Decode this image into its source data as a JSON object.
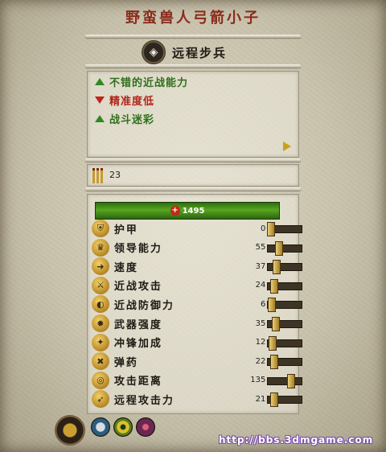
{
  "unit": {
    "title": "野蛮兽人弓箭小子",
    "class_name": "远程步兵",
    "class_icon": "ranged-infantry-icon"
  },
  "traits": [
    {
      "text": "不错的近战能力",
      "type": "positive",
      "color": "#2f6f1c"
    },
    {
      "text": "精准度低",
      "type": "negative",
      "color": "#b3241a"
    },
    {
      "text": "战斗迷彩",
      "type": "positive",
      "color": "#2f6f1c"
    }
  ],
  "ammo": {
    "value": "23",
    "icon": "arrows-ammo-icon"
  },
  "health": {
    "value": "1495",
    "icon": "health-cross-icon"
  },
  "stats": [
    {
      "label": "护甲",
      "value": "0",
      "icon": "armor-icon",
      "level": 0.0
    },
    {
      "label": "领导能力",
      "value": "55",
      "icon": "leadership-icon",
      "level": 0.28
    },
    {
      "label": "速度",
      "value": "37",
      "icon": "speed-icon",
      "level": 0.2
    },
    {
      "label": "近战攻击",
      "value": "24",
      "icon": "melee-attack-icon",
      "level": 0.12
    },
    {
      "label": "近战防御力",
      "value": "6",
      "icon": "melee-defense-icon",
      "level": 0.03
    },
    {
      "label": "武器强度",
      "value": "35",
      "icon": "weapon-strength-icon",
      "level": 0.18
    },
    {
      "label": "冲锋加成",
      "value": "12",
      "icon": "charge-bonus-icon",
      "level": 0.06
    },
    {
      "label": "弹药",
      "value": "22",
      "icon": "ammunition-icon",
      "level": 0.12
    },
    {
      "label": "攻击距离",
      "value": "135",
      "icon": "range-icon",
      "level": 0.72
    },
    {
      "label": "远程攻击力",
      "value": "21",
      "icon": "missile-damage-icon",
      "level": 0.11
    }
  ],
  "abilities": [
    "faction-emblem-icon",
    "ability-shield-icon",
    "ability-eye-icon",
    "ability-claw-icon"
  ],
  "watermark": "http://bbs.3dmgame.com"
}
